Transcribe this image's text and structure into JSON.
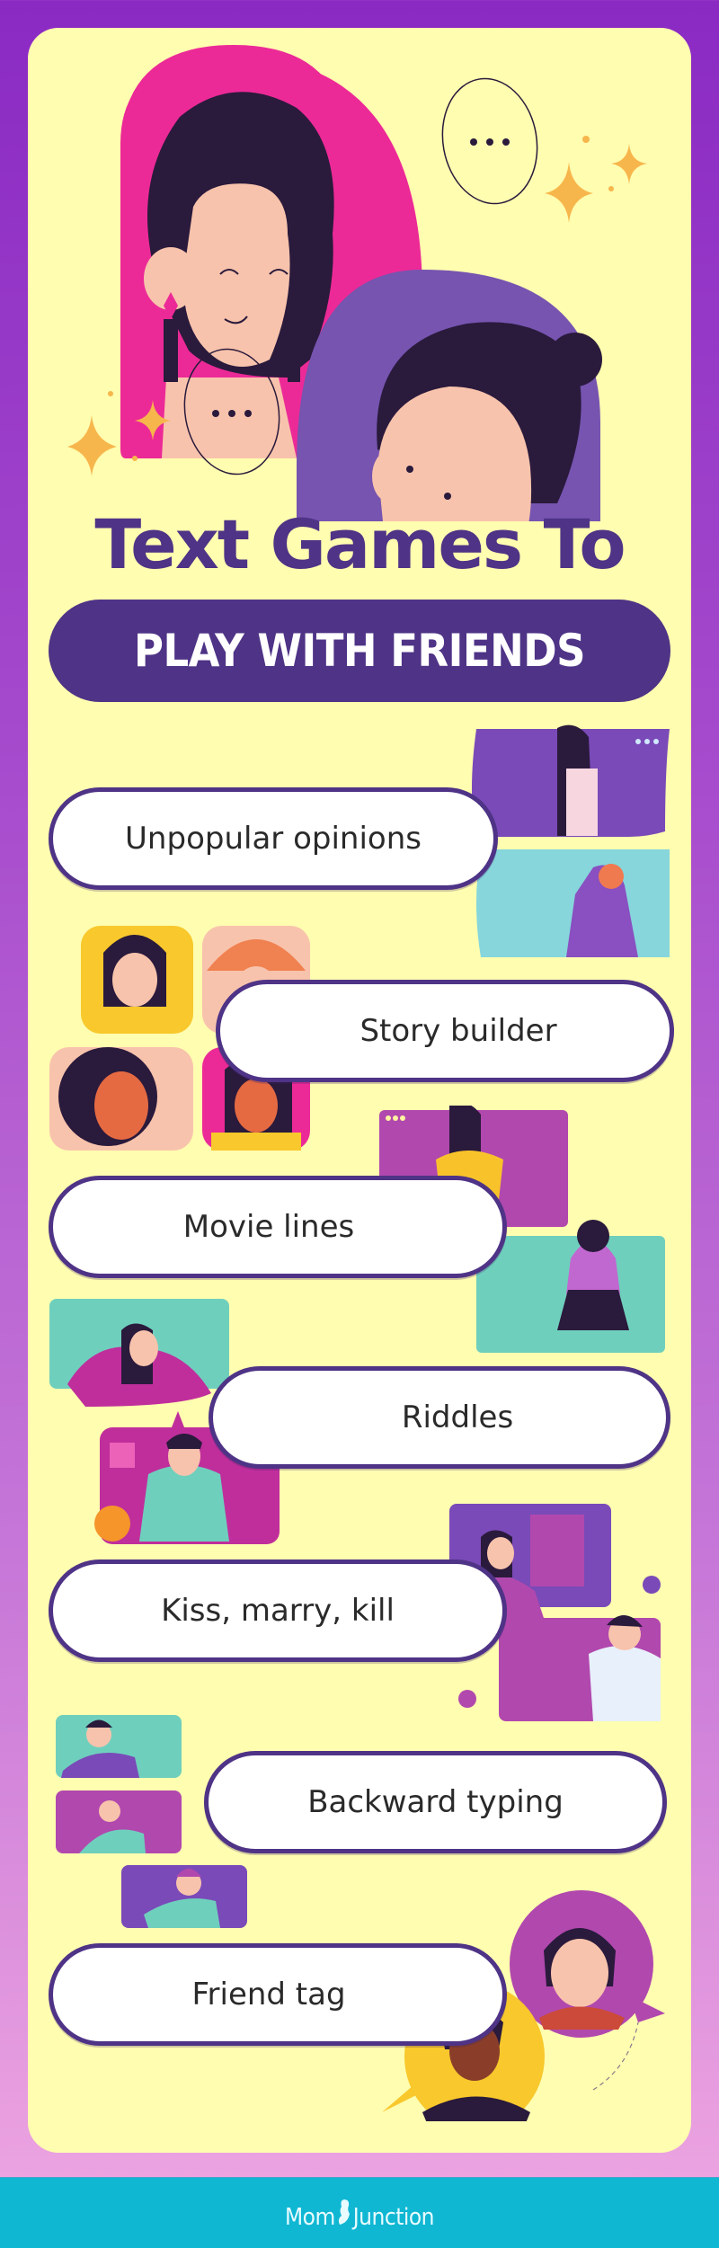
{
  "header": {
    "title_line1": "Text Games To",
    "title_line2": "PLAY WITH FRIENDS"
  },
  "games": [
    {
      "label": "Unpopular opinions",
      "side": "left"
    },
    {
      "label": "Story builder",
      "side": "right"
    },
    {
      "label": "Movie lines",
      "side": "left"
    },
    {
      "label": "Riddles",
      "side": "right"
    },
    {
      "label": "Kiss, marry, kill",
      "side": "left"
    },
    {
      "label": "Backward typing",
      "side": "right"
    },
    {
      "label": "Friend tag",
      "side": "left"
    }
  ],
  "footer": {
    "brand_left": "Mom",
    "brand_right": "Junction"
  },
  "colors": {
    "background_top": "#8a2ac3",
    "background_bottom": "#eca3e0",
    "card": "#fffdb0",
    "accent_purple": "#4e3386",
    "footer": "#0fb7d3",
    "sparkle": "#f7b64c",
    "pink": "#ec2a97",
    "violet": "#7654b0",
    "teal": "#6fcfbd",
    "magenta": "#b33fa4"
  },
  "icons": {
    "chat_bubble": "speech-bubble-ellipsis",
    "sparkle": "four-point-star"
  }
}
